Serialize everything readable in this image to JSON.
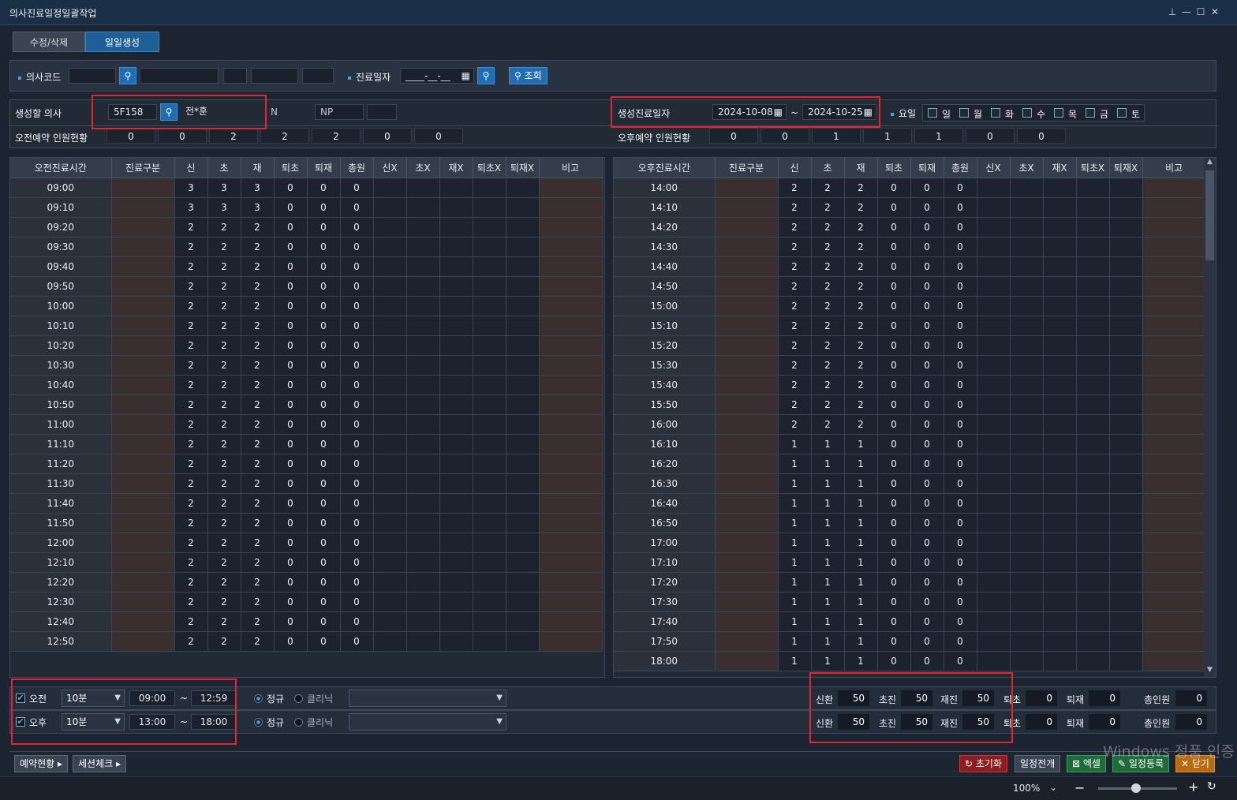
{
  "window": {
    "title": "의사진료일정일괄작업",
    "pin_glyph": "⊥",
    "min_glyph": "—",
    "max_glyph": "☐",
    "close_glyph": "✕"
  },
  "tabs": [
    {
      "label": "수정/삭제"
    },
    {
      "label": "일일생성"
    }
  ],
  "search": {
    "doctor_code_label": "의사코드",
    "date_label": "진료일자",
    "date_placeholder": "____-__-__",
    "query_button": "조회"
  },
  "gen": {
    "doctor_label": "생성할 의사",
    "doctor_code": "5F158",
    "doctor_name": "전*훈",
    "n_label": "N",
    "np_label": "NP",
    "period_label": "생성진료일자",
    "date_from": "2024-10-08",
    "date_to": "2024-10-25",
    "tilde": "~",
    "weekday_label": "요일",
    "weekdays": [
      "일",
      "월",
      "화",
      "수",
      "목",
      "금",
      "토"
    ],
    "am_status_label": "오전예약 인원현황",
    "am_status": [
      "0",
      "0",
      "2",
      "2",
      "2",
      "0",
      "0"
    ],
    "pm_status_label": "오후예약 인원현황",
    "pm_status": [
      "0",
      "0",
      "1",
      "1",
      "1",
      "0",
      "0"
    ]
  },
  "am_grid": {
    "headers": [
      "오전진료시간",
      "진료구분",
      "신",
      "초",
      "재",
      "퇴초",
      "퇴재",
      "총원",
      "신X",
      "초X",
      "재X",
      "퇴초X",
      "퇴재X",
      "비고"
    ],
    "rows": [
      [
        "09:00",
        "3",
        "3",
        "3",
        "0",
        "0",
        "0"
      ],
      [
        "09:10",
        "3",
        "3",
        "3",
        "0",
        "0",
        "0"
      ],
      [
        "09:20",
        "2",
        "2",
        "2",
        "0",
        "0",
        "0"
      ],
      [
        "09:30",
        "2",
        "2",
        "2",
        "0",
        "0",
        "0"
      ],
      [
        "09:40",
        "2",
        "2",
        "2",
        "0",
        "0",
        "0"
      ],
      [
        "09:50",
        "2",
        "2",
        "2",
        "0",
        "0",
        "0"
      ],
      [
        "10:00",
        "2",
        "2",
        "2",
        "0",
        "0",
        "0"
      ],
      [
        "10:10",
        "2",
        "2",
        "2",
        "0",
        "0",
        "0"
      ],
      [
        "10:20",
        "2",
        "2",
        "2",
        "0",
        "0",
        "0"
      ],
      [
        "10:30",
        "2",
        "2",
        "2",
        "0",
        "0",
        "0"
      ],
      [
        "10:40",
        "2",
        "2",
        "2",
        "0",
        "0",
        "0"
      ],
      [
        "10:50",
        "2",
        "2",
        "2",
        "0",
        "0",
        "0"
      ],
      [
        "11:00",
        "2",
        "2",
        "2",
        "0",
        "0",
        "0"
      ],
      [
        "11:10",
        "2",
        "2",
        "2",
        "0",
        "0",
        "0"
      ],
      [
        "11:20",
        "2",
        "2",
        "2",
        "0",
        "0",
        "0"
      ],
      [
        "11:30",
        "2",
        "2",
        "2",
        "0",
        "0",
        "0"
      ],
      [
        "11:40",
        "2",
        "2",
        "2",
        "0",
        "0",
        "0"
      ],
      [
        "11:50",
        "2",
        "2",
        "2",
        "0",
        "0",
        "0"
      ],
      [
        "12:00",
        "2",
        "2",
        "2",
        "0",
        "0",
        "0"
      ],
      [
        "12:10",
        "2",
        "2",
        "2",
        "0",
        "0",
        "0"
      ],
      [
        "12:20",
        "2",
        "2",
        "2",
        "0",
        "0",
        "0"
      ],
      [
        "12:30",
        "2",
        "2",
        "2",
        "0",
        "0",
        "0"
      ],
      [
        "12:40",
        "2",
        "2",
        "2",
        "0",
        "0",
        "0"
      ],
      [
        "12:50",
        "2",
        "2",
        "2",
        "0",
        "0",
        "0"
      ]
    ]
  },
  "pm_grid": {
    "headers": [
      "오후진료시간",
      "진료구분",
      "신",
      "초",
      "재",
      "퇴초",
      "퇴재",
      "총원",
      "신X",
      "초X",
      "재X",
      "퇴초X",
      "퇴재X",
      "비고"
    ],
    "rows": [
      [
        "14:00",
        "2",
        "2",
        "2",
        "0",
        "0",
        "0"
      ],
      [
        "14:10",
        "2",
        "2",
        "2",
        "0",
        "0",
        "0"
      ],
      [
        "14:20",
        "2",
        "2",
        "2",
        "0",
        "0",
        "0"
      ],
      [
        "14:30",
        "2",
        "2",
        "2",
        "0",
        "0",
        "0"
      ],
      [
        "14:40",
        "2",
        "2",
        "2",
        "0",
        "0",
        "0"
      ],
      [
        "14:50",
        "2",
        "2",
        "2",
        "0",
        "0",
        "0"
      ],
      [
        "15:00",
        "2",
        "2",
        "2",
        "0",
        "0",
        "0"
      ],
      [
        "15:10",
        "2",
        "2",
        "2",
        "0",
        "0",
        "0"
      ],
      [
        "15:20",
        "2",
        "2",
        "2",
        "0",
        "0",
        "0"
      ],
      [
        "15:30",
        "2",
        "2",
        "2",
        "0",
        "0",
        "0"
      ],
      [
        "15:40",
        "2",
        "2",
        "2",
        "0",
        "0",
        "0"
      ],
      [
        "15:50",
        "2",
        "2",
        "2",
        "0",
        "0",
        "0"
      ],
      [
        "16:00",
        "2",
        "2",
        "2",
        "0",
        "0",
        "0"
      ],
      [
        "16:10",
        "1",
        "1",
        "1",
        "0",
        "0",
        "0"
      ],
      [
        "16:20",
        "1",
        "1",
        "1",
        "0",
        "0",
        "0"
      ],
      [
        "16:30",
        "1",
        "1",
        "1",
        "0",
        "0",
        "0"
      ],
      [
        "16:40",
        "1",
        "1",
        "1",
        "0",
        "0",
        "0"
      ],
      [
        "16:50",
        "1",
        "1",
        "1",
        "0",
        "0",
        "0"
      ],
      [
        "17:00",
        "1",
        "1",
        "1",
        "0",
        "0",
        "0"
      ],
      [
        "17:10",
        "1",
        "1",
        "1",
        "0",
        "0",
        "0"
      ],
      [
        "17:20",
        "1",
        "1",
        "1",
        "0",
        "0",
        "0"
      ],
      [
        "17:30",
        "1",
        "1",
        "1",
        "0",
        "0",
        "0"
      ],
      [
        "17:40",
        "1",
        "1",
        "1",
        "0",
        "0",
        "0"
      ],
      [
        "17:50",
        "1",
        "1",
        "1",
        "0",
        "0",
        "0"
      ],
      [
        "18:00",
        "1",
        "1",
        "1",
        "0",
        "0",
        "0"
      ]
    ]
  },
  "settings": {
    "am": {
      "label": "오전",
      "interval": "10분",
      "start": "09:00",
      "end": "12:59",
      "regular": "정규",
      "clinic": "클리닉",
      "new_label": "신환",
      "new_val": "50",
      "first_label": "초진",
      "first_val": "50",
      "re_label": "재진",
      "re_val": "50",
      "tc_label": "퇴초",
      "tc_val": "0",
      "tr_label": "퇴재",
      "tr_val": "0",
      "total_label": "총인원",
      "total_val": "0"
    },
    "pm": {
      "label": "오후",
      "interval": "10분",
      "start": "13:00",
      "end": "18:00",
      "regular": "정규",
      "clinic": "클리닉",
      "new_label": "신환",
      "new_val": "50",
      "first_label": "초진",
      "first_val": "50",
      "re_label": "재진",
      "re_val": "50",
      "tc_label": "퇴초",
      "tc_val": "0",
      "tr_label": "퇴재",
      "tr_val": "0",
      "total_label": "총인원",
      "total_val": "0"
    }
  },
  "bottom": {
    "reservation_status": "예약현황",
    "session_check": "세션체크",
    "reset": "초기화",
    "expand": "일정전개",
    "excel": "엑셀",
    "register": "일정등록",
    "close": "닫기"
  },
  "status": {
    "zoom": "100%"
  },
  "watermark": {
    "line1": "Windows 정품 인증"
  }
}
